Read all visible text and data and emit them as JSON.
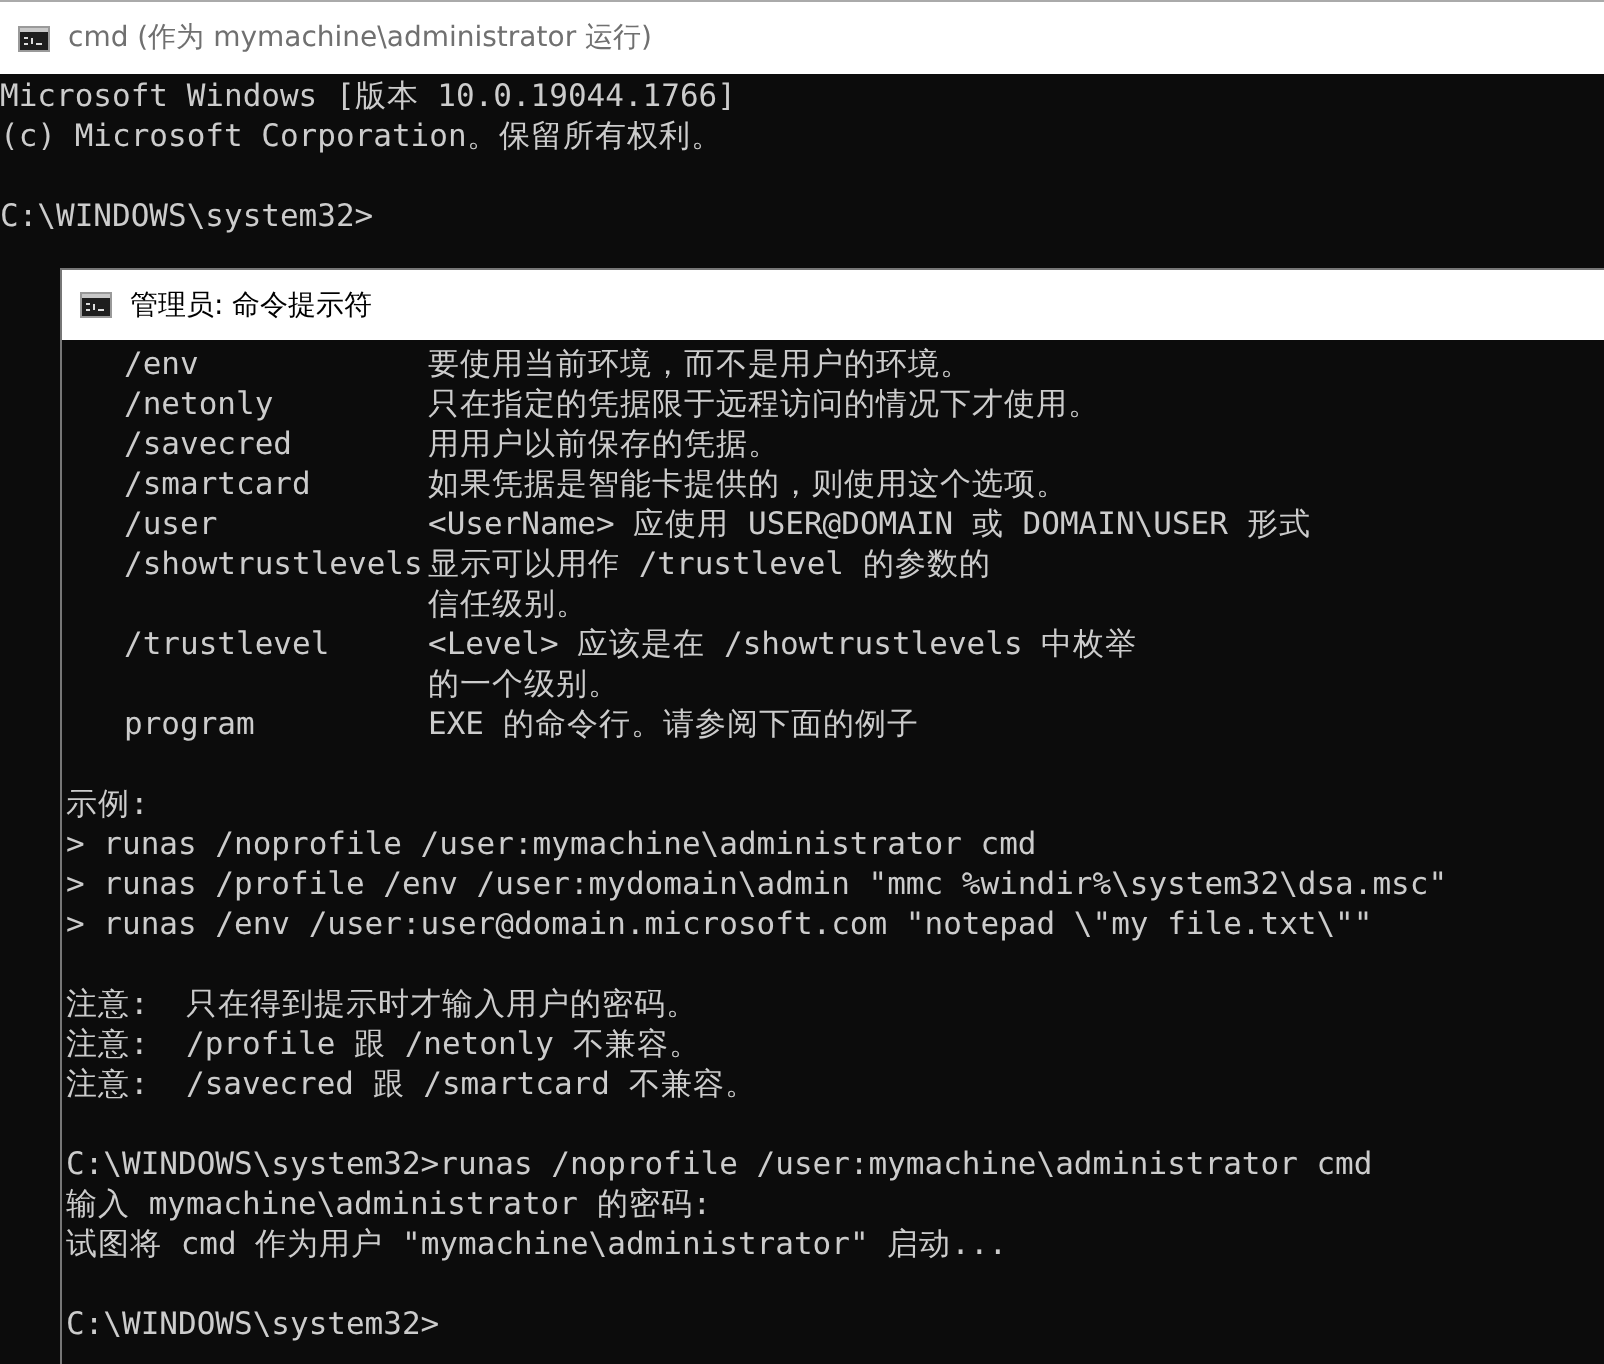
{
  "back_window": {
    "title": "cmd (作为 mymachine\\administrator 运行)",
    "paragraphs": [
      [
        "Microsoft Windows [版本 10.0.19044.1766]",
        "(c) Microsoft Corporation。保留所有权利。"
      ],
      [
        "C:\\WINDOWS\\system32>"
      ]
    ]
  },
  "front_window": {
    "title": "管理员: 命令提示符",
    "options": [
      {
        "name": "/env",
        "description": [
          "要使用当前环境，而不是用户的环境。"
        ]
      },
      {
        "name": "/netonly",
        "description": [
          "只在指定的凭据限于远程访问的情况下才使用。"
        ]
      },
      {
        "name": "/savecred",
        "description": [
          "用用户以前保存的凭据。"
        ]
      },
      {
        "name": "/smartcard",
        "description": [
          "如果凭据是智能卡提供的，则使用这个选项。"
        ]
      },
      {
        "name": "/user",
        "description": [
          "<UserName> 应使用 USER@DOMAIN 或 DOMAIN\\USER 形式"
        ]
      },
      {
        "name": "/showtrustlevels",
        "description": [
          "显示可以用作 /trustlevel 的参数的",
          "信任级别。"
        ]
      },
      {
        "name": "/trustlevel",
        "description": [
          "<Level> 应该是在 /showtrustlevels 中枚举",
          "的一个级别。"
        ]
      },
      {
        "name": "program",
        "description": [
          "EXE 的命令行。请参阅下面的例子"
        ]
      }
    ],
    "paragraphs": [
      [
        "示例:",
        "> runas /noprofile /user:mymachine\\administrator cmd",
        "> runas /profile /env /user:mydomain\\admin \"mmc %windir%\\system32\\dsa.msc\"",
        "> runas /env /user:user@domain.microsoft.com \"notepad \\\"my file.txt\\\"\""
      ],
      [
        "注意:  只在得到提示时才输入用户的密码。",
        "注意:  /profile 跟 /netonly 不兼容。",
        "注意:  /savecred 跟 /smartcard 不兼容。"
      ],
      [
        "C:\\WINDOWS\\system32>runas /noprofile /user:mymachine\\administrator cmd",
        "输入 mymachine\\administrator 的密码:",
        "试图将 cmd 作为用户 \"mymachine\\administrator\" 启动..."
      ],
      [
        "C:\\WINDOWS\\system32>"
      ]
    ]
  }
}
